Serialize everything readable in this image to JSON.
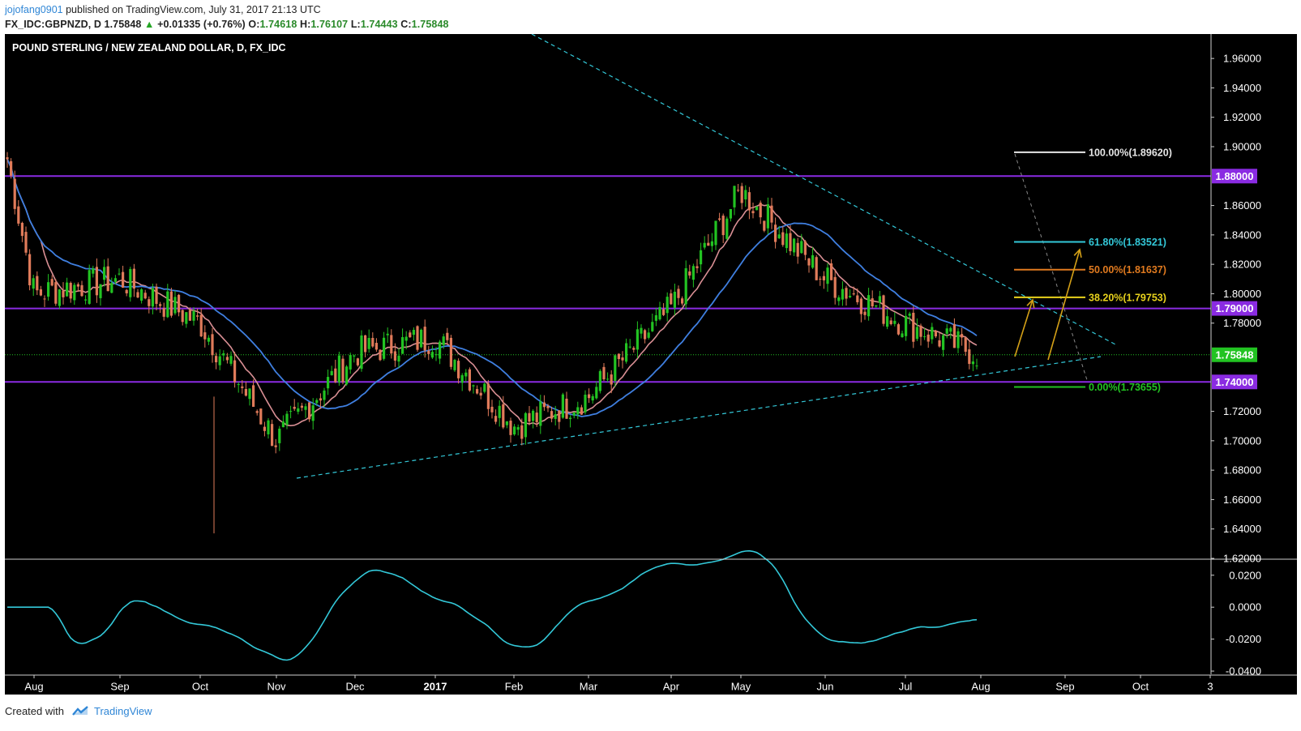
{
  "header": {
    "user": "jojofang0901",
    "published": "published on TradingView.com, July 31, 2017 21:13 UTC",
    "symbol": "FX_IDC:GBPNZD, D",
    "last": "1.75848",
    "change_arrow": "▲",
    "change": "+0.01335 (+0.76%)",
    "open_label": "O:",
    "open": "1.74618",
    "high_label": "H:",
    "high": "1.76107",
    "low_label": "L:",
    "low": "1.74443",
    "close_label": "C:",
    "close": "1.75848"
  },
  "footer": {
    "created_with": "Created with",
    "brand": "TradingView"
  },
  "colors": {
    "background": "#000000",
    "candle_up": "#22c322",
    "candle_down": "#e07b5a",
    "ma_fast": "#d98f94",
    "ma_slow": "#3f7fe0",
    "level_line": "#8a2be2",
    "trendline": "#33c8d8",
    "oscillator": "#33c8d8",
    "projection_arrow": "#d4a017",
    "last_price_tag": "#22c322"
  },
  "chart_data": [
    {
      "type": "candlestick",
      "title": "POUND STERLING / NEW ZEALAND DOLLAR, D, FX_IDC",
      "x_tick_labels": [
        "Aug",
        "Sep",
        "Oct",
        "Nov",
        "Dec",
        "2017",
        "Feb",
        "Mar",
        "Apr",
        "May",
        "Jun",
        "Jul",
        "Aug",
        "Sep",
        "Oct",
        "3"
      ],
      "y_tick_labels": [
        "1.96000",
        "1.94000",
        "1.92000",
        "1.90000",
        "1.86000",
        "1.84000",
        "1.82000",
        "1.80000",
        "1.78000",
        "1.72000",
        "1.70000",
        "1.68000",
        "1.66000",
        "1.64000",
        "1.62000"
      ],
      "ylim": [
        1.62,
        1.97
      ],
      "last_price": 1.75848,
      "last_price_label": "1.75848",
      "horizontal_levels": [
        {
          "value": 1.88,
          "label": "1.88000"
        },
        {
          "value": 1.79,
          "label": "1.79000"
        },
        {
          "value": 1.74,
          "label": "1.74000"
        }
      ],
      "fibonacci": [
        {
          "value": 1.8962,
          "label": "100.00%(1.89620)",
          "color": "#e6e6e6"
        },
        {
          "value": 1.83521,
          "label": "61.80%(1.83521)",
          "color": "#33c8d8"
        },
        {
          "value": 1.81637,
          "label": "50.00%(1.81637)",
          "color": "#e07a1f"
        },
        {
          "value": 1.79753,
          "label": "38.20%(1.79753)",
          "color": "#e8d21c"
        },
        {
          "value": 1.73655,
          "label": "0.00%(1.73655)",
          "color": "#22c322"
        }
      ],
      "approx_closes": {
        "months": [
          "Jul",
          "Aug",
          "Sep",
          "Oct",
          "Nov",
          "Dec",
          "Jan",
          "Feb",
          "Mar",
          "Apr",
          "May",
          "Jun",
          "Jul",
          "Aug"
        ],
        "values": [
          1.9,
          1.8,
          1.81,
          1.78,
          1.7,
          1.76,
          1.77,
          1.71,
          1.73,
          1.79,
          1.87,
          1.81,
          1.78,
          1.758
        ]
      }
    },
    {
      "type": "line",
      "title": "",
      "y_tick_labels": [
        "0.0200",
        "0.0000",
        "-0.0200",
        "-0.0400"
      ],
      "ylim": [
        -0.042,
        0.028
      ]
    }
  ]
}
